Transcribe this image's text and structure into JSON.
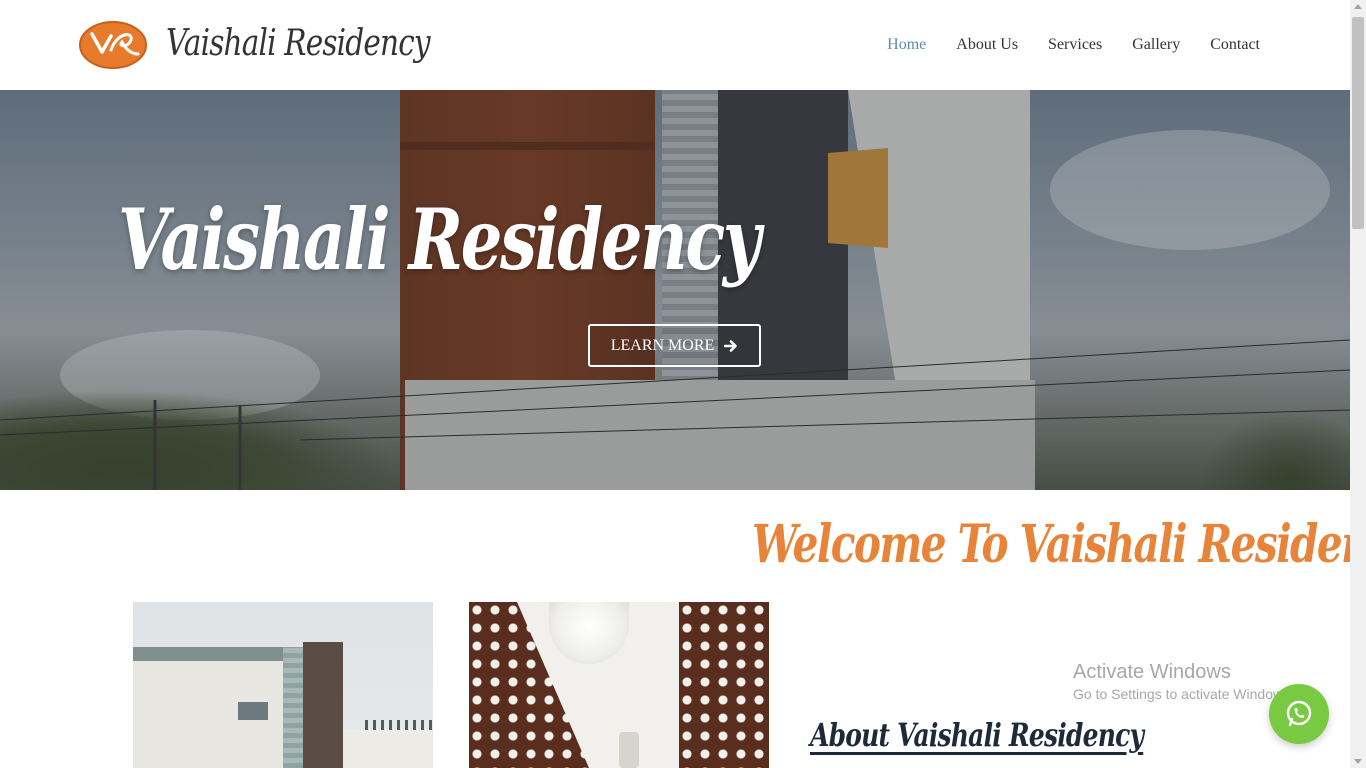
{
  "header": {
    "brand": "Vaishali Residency",
    "logo_text": "VR",
    "nav": [
      {
        "label": "Home",
        "active": true
      },
      {
        "label": "About Us",
        "active": false
      },
      {
        "label": "Services",
        "active": false
      },
      {
        "label": "Gallery",
        "active": false
      },
      {
        "label": "Contact",
        "active": false
      }
    ]
  },
  "hero": {
    "title": "Vaishali Residency",
    "button_label": "LEARN MORE",
    "button_icon": "arrow-right-icon"
  },
  "welcome": {
    "title": "Welcome To Vaishali Residency"
  },
  "about": {
    "title": "About Vaishali Residency"
  },
  "watermark": {
    "line1": "Activate Windows",
    "line2": "Go to Settings to activate Windows."
  },
  "whatsapp": {
    "icon": "whatsapp-icon"
  },
  "colors": {
    "accent_orange": "#e8843a",
    "nav_active": "#5b8db3",
    "whatsapp_green": "#7ac943"
  }
}
